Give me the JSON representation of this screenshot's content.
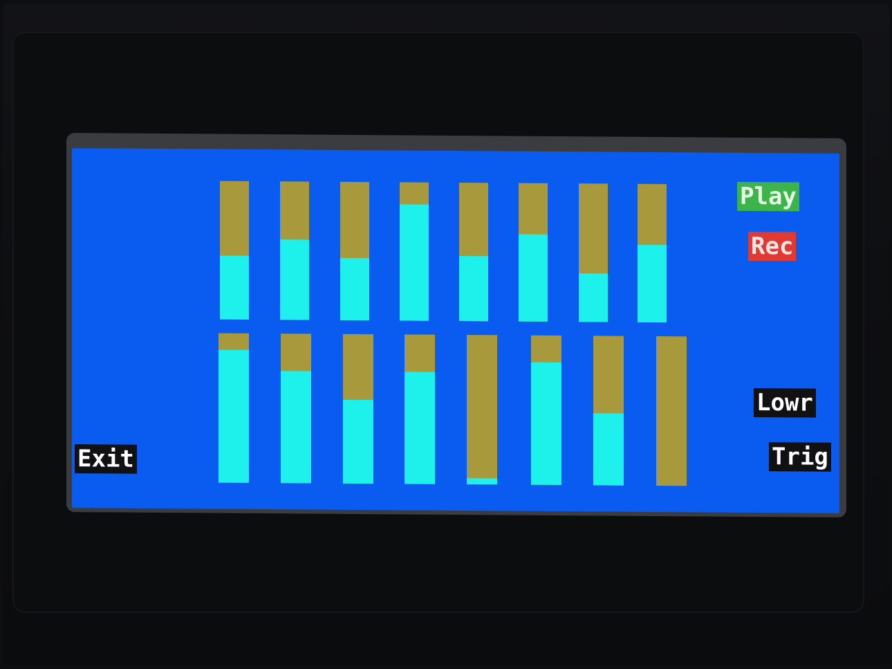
{
  "buttons": {
    "play": "Play",
    "rec": "Rec",
    "lowr": "Lowr",
    "trig": "Trig",
    "exit": "Exit"
  },
  "colors": {
    "screen_background": "#0a5cf0",
    "bar_track": "#a89a3c",
    "bar_fill": "#1ef0ec",
    "play_button": "#3cb44a",
    "rec_button": "#e03a32",
    "dark_button": "#111114"
  },
  "sliders": {
    "top_row_levels": [
      0.46,
      0.58,
      0.45,
      0.84,
      0.47,
      0.63,
      0.35,
      0.56
    ],
    "bottom_row_levels": [
      0.89,
      0.75,
      0.56,
      0.75,
      0.04,
      0.82,
      0.48,
      0.0
    ]
  }
}
